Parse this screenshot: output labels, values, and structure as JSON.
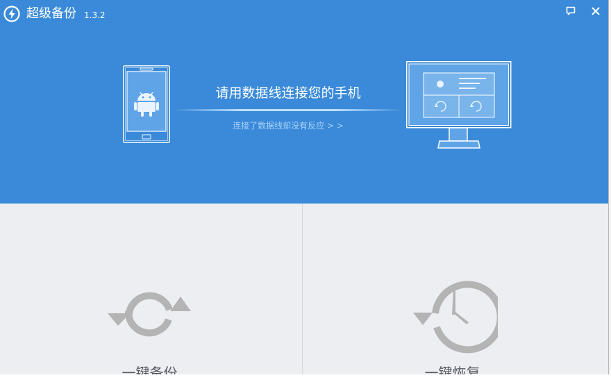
{
  "window": {
    "app_name": "超级备份",
    "version": "1.3.2"
  },
  "titlebar_buttons": [
    {
      "icon": "feedback-icon"
    },
    {
      "icon": "close-icon"
    }
  ],
  "connect": {
    "title": "请用数据线连接您的手机",
    "help_link": "连接了数据线却没有反应 > >"
  },
  "actions": {
    "backup": {
      "label": "一键备份",
      "icon": "sync-arrows-icon"
    },
    "restore": {
      "label": "一键恢复",
      "icon": "history-clock-icon"
    }
  },
  "colors": {
    "header_bg": "#3a8ad9",
    "bottom_bg": "#eceef1",
    "icon_gray": "#b4b4b4",
    "label_gray": "#555a60",
    "link_blue": "#a9d2f7"
  }
}
